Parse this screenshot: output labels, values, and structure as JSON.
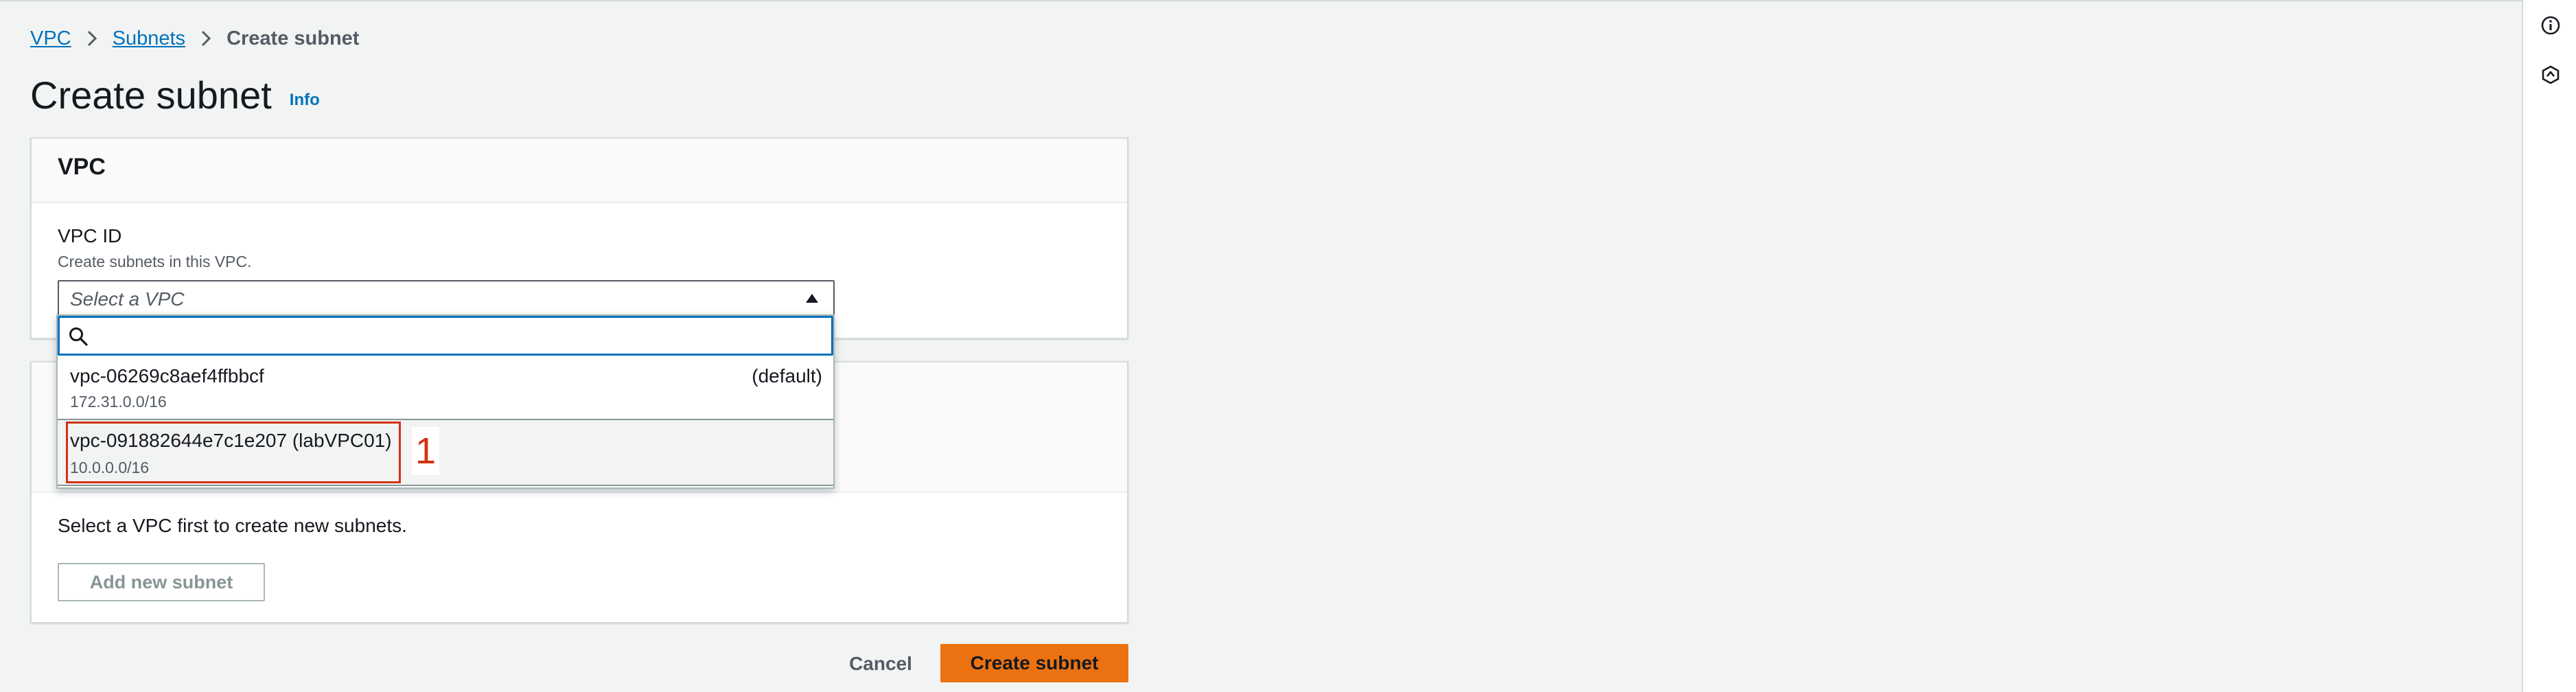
{
  "breadcrumb": {
    "items": [
      "VPC",
      "Subnets"
    ],
    "current": "Create subnet"
  },
  "page": {
    "title": "Create subnet",
    "info_link": "Info"
  },
  "vpc_panel": {
    "title": "VPC",
    "field_label": "VPC ID",
    "field_description": "Create subnets in this VPC.",
    "select_placeholder": "Select a VPC"
  },
  "dropdown": {
    "search_value": "",
    "options": [
      {
        "name": "vpc-06269c8aef4ffbbcf",
        "cidr": "172.31.0.0/16",
        "tag": "(default)"
      },
      {
        "name": "vpc-091882644e7c1e207 (labVPC01)",
        "cidr": "10.0.0.0/16",
        "tag": ""
      }
    ],
    "highlighted_index": 1
  },
  "annotation": {
    "step_number": "1",
    "color": "#d13212"
  },
  "subnet_panel": {
    "message": "Select a VPC first to create new subnets.",
    "add_button_label": "Add new subnet"
  },
  "footer": {
    "cancel_label": "Cancel",
    "create_label": "Create subnet"
  },
  "colors": {
    "link": "#0073bb",
    "primary_button": "#ec7211",
    "background": "#f2f3f3"
  },
  "icons": {
    "right_bar": [
      "info-circle-icon",
      "hexagon-settings-icon"
    ],
    "search": "search-icon",
    "caret": "caret-up-icon",
    "breadcrumb_separator": "chevron-right-icon"
  }
}
